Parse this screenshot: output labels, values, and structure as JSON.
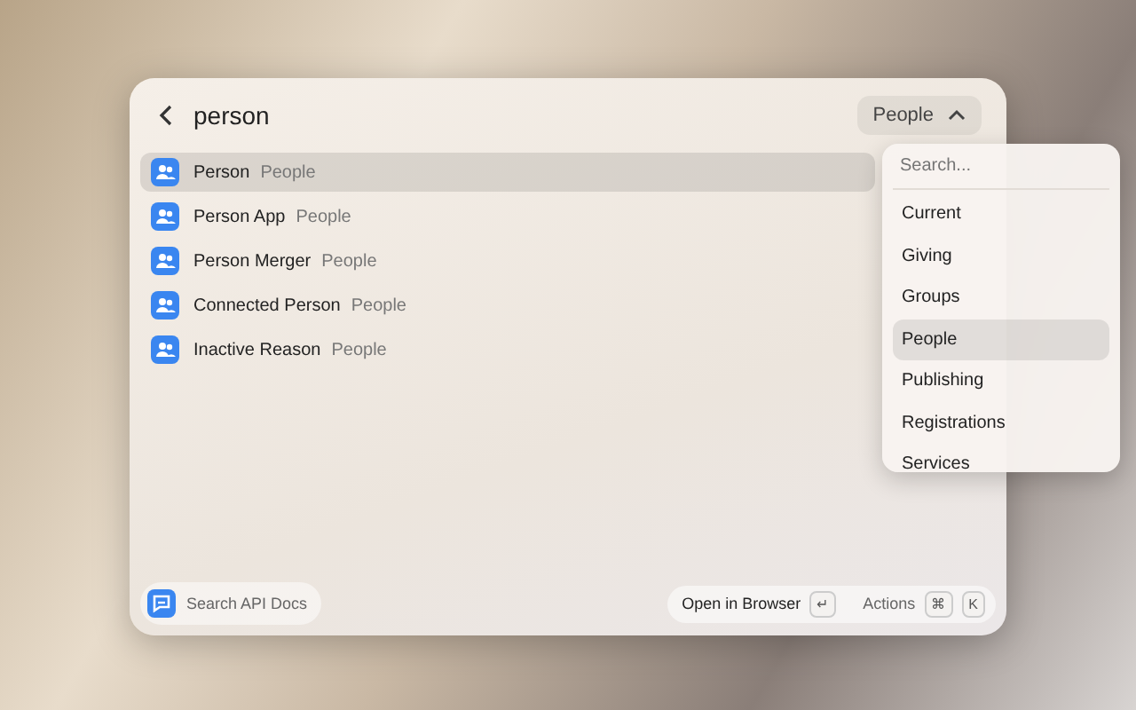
{
  "search": {
    "value": "person"
  },
  "filter": {
    "label": "People",
    "expanded": true
  },
  "results": [
    {
      "title": "Person",
      "category": "People",
      "selected": true
    },
    {
      "title": "Person App",
      "category": "People",
      "selected": false
    },
    {
      "title": "Person Merger",
      "category": "People",
      "selected": false
    },
    {
      "title": "Connected Person",
      "category": "People",
      "selected": false
    },
    {
      "title": "Inactive Reason",
      "category": "People",
      "selected": false
    }
  ],
  "dropdown": {
    "placeholder": "Search...",
    "items": [
      {
        "label": "Current",
        "selected": false
      },
      {
        "label": "Giving",
        "selected": false
      },
      {
        "label": "Groups",
        "selected": false
      },
      {
        "label": "People",
        "selected": true
      },
      {
        "label": "Publishing",
        "selected": false
      },
      {
        "label": "Registrations",
        "selected": false
      },
      {
        "label": "Services",
        "selected": false
      }
    ]
  },
  "footer": {
    "docs": "Search API Docs",
    "primary_action": "Open in Browser",
    "primary_key": "↵",
    "actions": "Actions",
    "action_keys": [
      "⌘",
      "K"
    ]
  }
}
